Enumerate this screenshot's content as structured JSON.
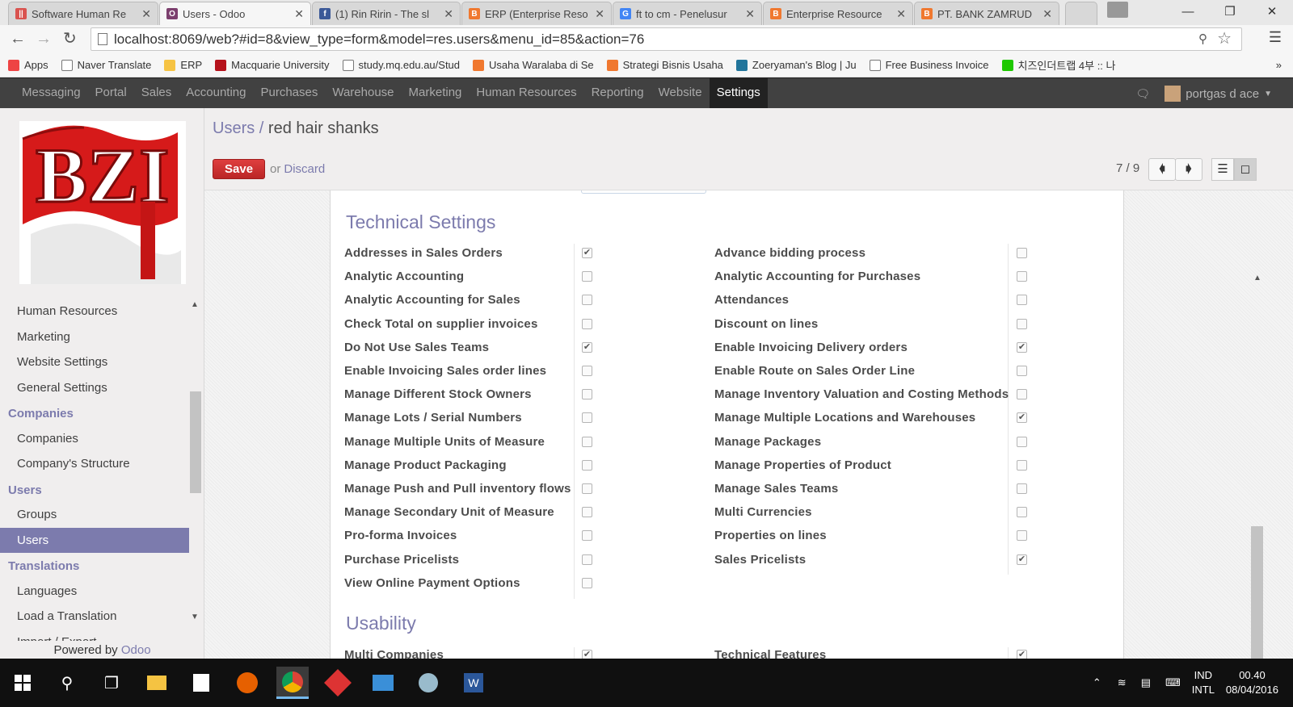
{
  "browser": {
    "tabs": [
      {
        "title": "Software Human Re",
        "color": "#d9534f",
        "glyph": "||"
      },
      {
        "title": "Users - Odoo",
        "color": "#7c3f6e",
        "glyph": "O"
      },
      {
        "title": "(1) Rin Ririn - The sl",
        "color": "#3b5998",
        "glyph": "f"
      },
      {
        "title": "ERP (Enterprise Reso",
        "color": "#f0782f",
        "glyph": "B"
      },
      {
        "title": "ft to cm - Penelusur",
        "color": "#4285f4",
        "glyph": "G"
      },
      {
        "title": "Enterprise Resource",
        "color": "#f0782f",
        "glyph": "B"
      },
      {
        "title": "PT. BANK ZAMRUD",
        "color": "#f0782f",
        "glyph": "B"
      }
    ],
    "url": "localhost:8069/web?#id=8&view_type=form&model=res.users&menu_id=85&action=76",
    "bookmarks": [
      {
        "label": "Apps",
        "color": "#e44"
      },
      {
        "label": "Naver Translate",
        "color": "#fff"
      },
      {
        "label": "ERP",
        "color": "#f6c343"
      },
      {
        "label": "Macquarie University",
        "color": "#b5121b"
      },
      {
        "label": "study.mq.edu.au/Stud",
        "color": "#fff"
      },
      {
        "label": "Usaha Waralaba di Se",
        "color": "#f0782f"
      },
      {
        "label": "Strategi Bisnis Usaha",
        "color": "#f0782f"
      },
      {
        "label": "Zoeryaman's Blog | Ju",
        "color": "#21759b"
      },
      {
        "label": "Free Business Invoice",
        "color": "#fff"
      },
      {
        "label": "치즈인더트랩 4부 :: 나",
        "color": "#1ec800"
      }
    ],
    "more": "»"
  },
  "odoo": {
    "menu": [
      "Messaging",
      "Portal",
      "Sales",
      "Accounting",
      "Purchases",
      "Warehouse",
      "Marketing",
      "Human Resources",
      "Reporting",
      "Website",
      "Settings"
    ],
    "active_menu": "Settings",
    "user": "portgas d ace",
    "logo_text": "BZI"
  },
  "sidebar": {
    "items": [
      {
        "label": "Human Resources",
        "type": "item"
      },
      {
        "label": "Marketing",
        "type": "item"
      },
      {
        "label": "Website Settings",
        "type": "item"
      },
      {
        "label": "General Settings",
        "type": "item"
      },
      {
        "label": "Companies",
        "type": "head"
      },
      {
        "label": "Companies",
        "type": "item"
      },
      {
        "label": "Company's Structure",
        "type": "item"
      },
      {
        "label": "Users",
        "type": "head"
      },
      {
        "label": "Groups",
        "type": "item"
      },
      {
        "label": "Users",
        "type": "item",
        "selected": true
      },
      {
        "label": "Translations",
        "type": "head"
      },
      {
        "label": "Languages",
        "type": "item"
      },
      {
        "label": "Load a Translation",
        "type": "item"
      },
      {
        "label": "Import / Export",
        "type": "item"
      }
    ],
    "powered_prefix": "Powered by",
    "powered_brand": "Odoo"
  },
  "form": {
    "breadcrumb_parent": "Users",
    "breadcrumb_sep": "/",
    "record_name": "red hair shanks",
    "save_label": "Save",
    "or_label": "or",
    "discard_label": "Discard",
    "pager": "7 / 9"
  },
  "technical_settings": {
    "title": "Technical Settings",
    "left": [
      {
        "label": "Addresses in Sales Orders",
        "checked": true
      },
      {
        "label": "Analytic Accounting",
        "checked": false
      },
      {
        "label": "Analytic Accounting for Sales",
        "checked": false
      },
      {
        "label": "Check Total on supplier invoices",
        "checked": false
      },
      {
        "label": "Do Not Use Sales Teams",
        "checked": true
      },
      {
        "label": "Enable Invoicing Sales order lines",
        "checked": false
      },
      {
        "label": "Manage Different Stock Owners",
        "checked": false
      },
      {
        "label": "Manage Lots / Serial Numbers",
        "checked": false
      },
      {
        "label": "Manage Multiple Units of Measure",
        "checked": false
      },
      {
        "label": "Manage Product Packaging",
        "checked": false
      },
      {
        "label": "Manage Push and Pull inventory flows",
        "checked": false
      },
      {
        "label": "Manage Secondary Unit of Measure",
        "checked": false
      },
      {
        "label": "Pro-forma Invoices",
        "checked": false
      },
      {
        "label": "Purchase Pricelists",
        "checked": false
      },
      {
        "label": "View Online Payment Options",
        "checked": false
      }
    ],
    "right": [
      {
        "label": "Advance bidding process",
        "checked": false
      },
      {
        "label": "Analytic Accounting for Purchases",
        "checked": false
      },
      {
        "label": "Attendances",
        "checked": false
      },
      {
        "label": "Discount on lines",
        "checked": false
      },
      {
        "label": "Enable Invoicing Delivery orders",
        "checked": true
      },
      {
        "label": "Enable Route on Sales Order Line",
        "checked": false
      },
      {
        "label": "Manage Inventory Valuation and Costing Methods",
        "checked": false
      },
      {
        "label": "Manage Multiple Locations and Warehouses",
        "checked": true
      },
      {
        "label": "Manage Packages",
        "checked": false
      },
      {
        "label": "Manage Properties of Product",
        "checked": false
      },
      {
        "label": "Manage Sales Teams",
        "checked": false
      },
      {
        "label": "Multi Currencies",
        "checked": false
      },
      {
        "label": "Properties on lines",
        "checked": false
      },
      {
        "label": "Sales Pricelists",
        "checked": true
      }
    ]
  },
  "usability": {
    "title": "Usability",
    "left": [
      {
        "label": "Multi Companies",
        "checked": true
      }
    ],
    "right": [
      {
        "label": "Technical Features",
        "checked": true
      }
    ]
  },
  "taskbar": {
    "lang_top": "IND",
    "lang_bottom": "INTL",
    "time": "00.40",
    "date": "08/04/2016"
  }
}
